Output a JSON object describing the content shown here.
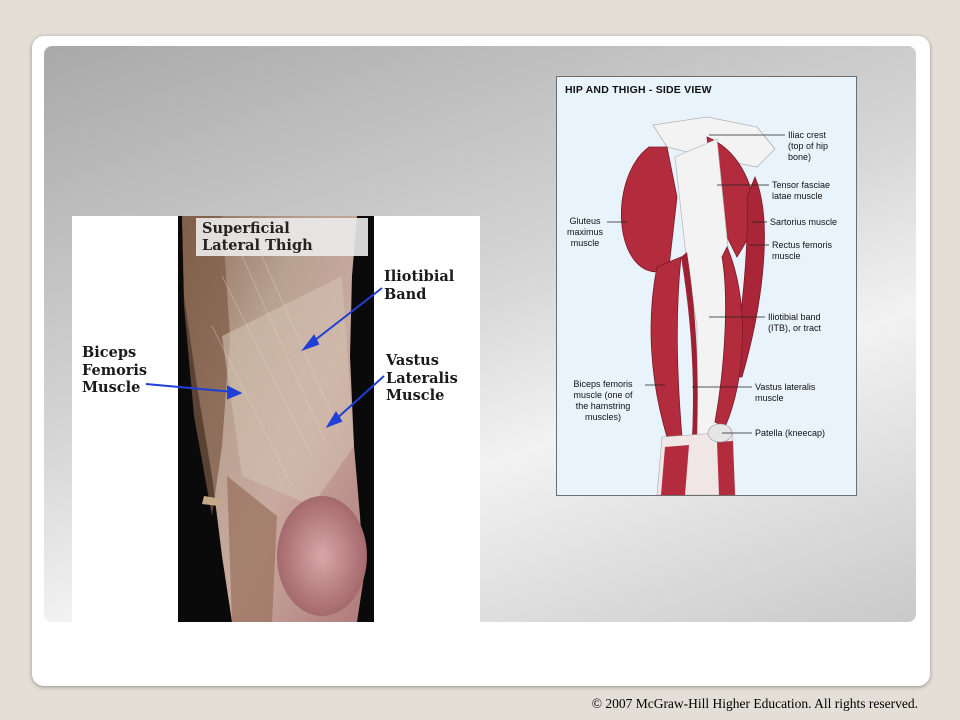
{
  "photo": {
    "title": "Superficial\nLateral Thigh",
    "labels": {
      "iliotibial": "Iliotibial\nBand",
      "biceps": "Biceps\nFemoris\nMuscle",
      "vastus": "Vastus\nLateralis\nMuscle"
    }
  },
  "diagram": {
    "title": "HIP AND THIGH - SIDE VIEW",
    "labels": {
      "iliac_crest": "Iliac crest\n(top of hip\nbone)",
      "tensor": "Tensor fasciae\nlatae muscle",
      "sartorius": "Sartorius muscle",
      "rectus": "Rectus femoris\nmuscle",
      "itb": "Iliotibial band\n(ITB), or tract",
      "vastus": "Vastus lateralis\nmuscle",
      "patella": "Patella (kneecap)",
      "gluteus": "Gluteus\nmaximus\nmuscle",
      "biceps": "Biceps femoris\nmuscle (one of\nthe hamstring\nmuscles)"
    }
  },
  "footer": {
    "copyright": "© 2007 McGraw-Hill Higher Education. All rights reserved."
  },
  "colors": {
    "muscle": "#b22c3e",
    "tendon": "#f3f3f3",
    "arrow": "#1f3fd6"
  }
}
